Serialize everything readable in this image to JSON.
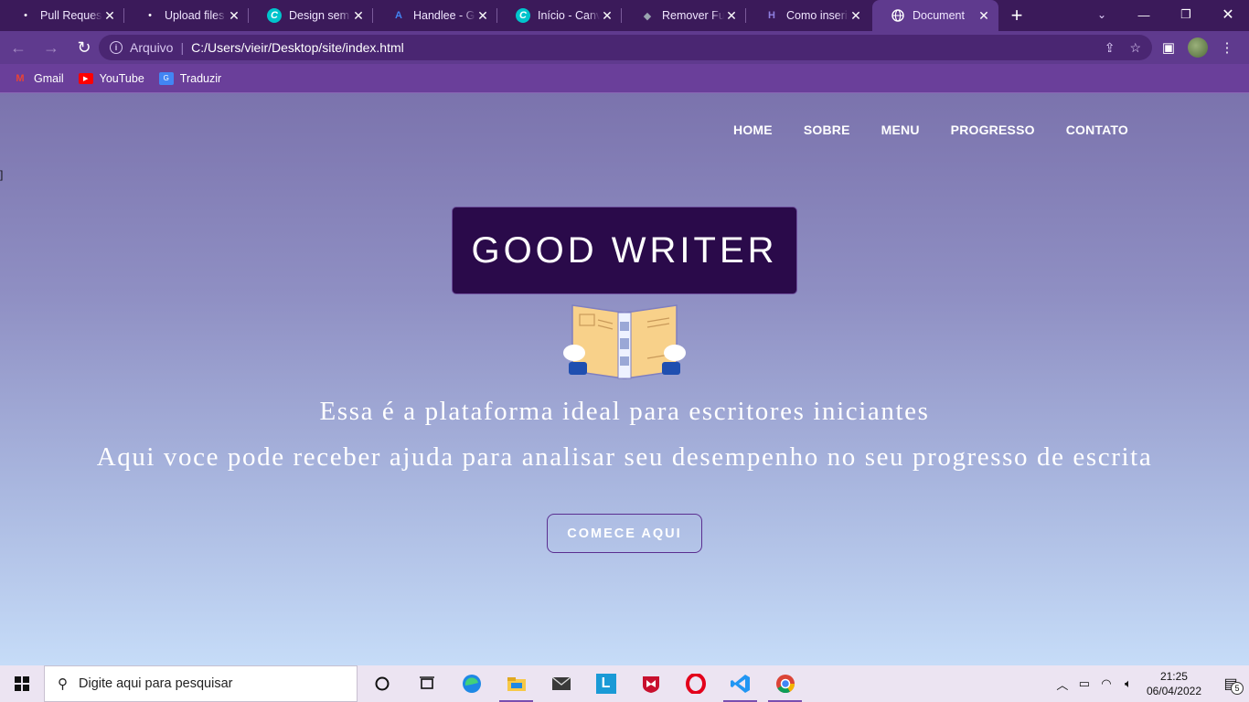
{
  "browser": {
    "tabs": [
      {
        "title": "Pull Requests",
        "icon": "github-icon",
        "color": "#ffffff",
        "glyph": "●"
      },
      {
        "title": "Upload files · ",
        "icon": "github-icon",
        "color": "#ffffff",
        "glyph": "●"
      },
      {
        "title": "Design sem n",
        "icon": "canva-icon",
        "color": "#00c4cc",
        "glyph": "C"
      },
      {
        "title": "Handlee - Go",
        "icon": "google-fonts-icon",
        "color": "#4285f4",
        "glyph": "A"
      },
      {
        "title": "Início - Canva",
        "icon": "canva-icon",
        "color": "#00c4cc",
        "glyph": "C"
      },
      {
        "title": "Remover Fun",
        "icon": "layers-icon",
        "color": "#9aa4b0",
        "glyph": "◆"
      },
      {
        "title": "Como inserir",
        "icon": "hashnode-icon",
        "color": "#8f7fe0",
        "glyph": "H"
      },
      {
        "title": "Document",
        "icon": "globe-icon",
        "color": "#ffffff",
        "glyph": "🌐",
        "active": true
      }
    ],
    "address": {
      "scheme_label": "Arquivo",
      "url": "C:/Users/vieir/Desktop/site/index.html"
    },
    "bookmarks": [
      {
        "label": "Gmail",
        "icon": "gmail-icon"
      },
      {
        "label": "YouTube",
        "icon": "youtube-icon"
      },
      {
        "label": "Traduzir",
        "icon": "translate-icon"
      }
    ]
  },
  "page": {
    "nav": [
      "HOME",
      "SOBRE",
      "MENU",
      "PROGRESSO",
      "CONTATO"
    ],
    "stray_char": "]",
    "logo_text": "GOOD WRITER",
    "tagline": "Essa é a plataforma ideal para escritores iniciantes",
    "subtitle": "Aqui voce pode receber ajuda para analisar seu desempenho no seu progresso de escrita",
    "cta_label": "COMECE AQUI",
    "colors": {
      "logo_bg": "#2a0a4a",
      "cta_border": "#5a2e90",
      "book_page": "#f8d18a",
      "sleeve": "#1f4fb0"
    }
  },
  "taskbar": {
    "search_placeholder": "Digite aqui para pesquisar",
    "time": "21:25",
    "date": "06/04/2022",
    "notification_count": "5"
  }
}
